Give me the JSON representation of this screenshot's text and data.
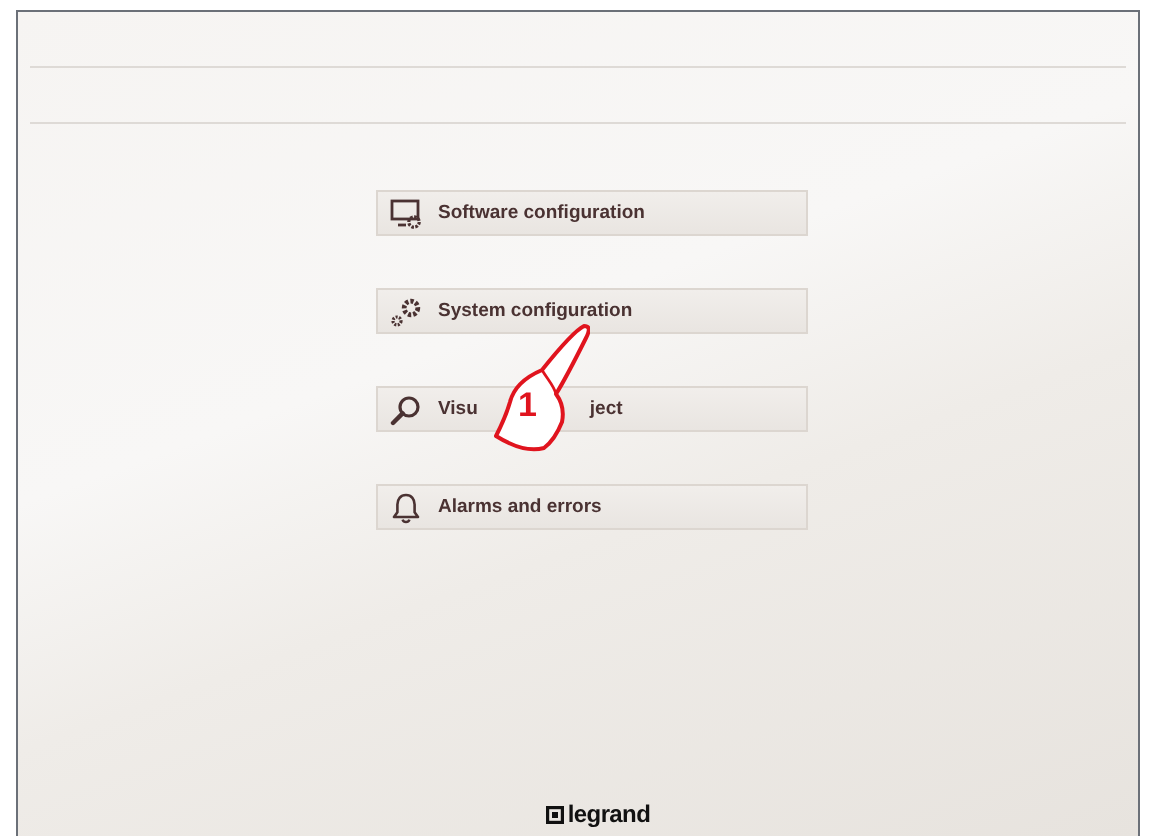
{
  "menu": [
    {
      "kind": "monitor",
      "label": "Software configuration"
    },
    {
      "kind": "gears",
      "label": "System configuration"
    },
    {
      "kind": "search",
      "label": "Visu",
      "label_after_gap": "ject"
    },
    {
      "kind": "bell",
      "label": "Alarms and errors"
    }
  ],
  "callout": {
    "number": "1"
  },
  "footer": {
    "logo_text": "legrand"
  }
}
